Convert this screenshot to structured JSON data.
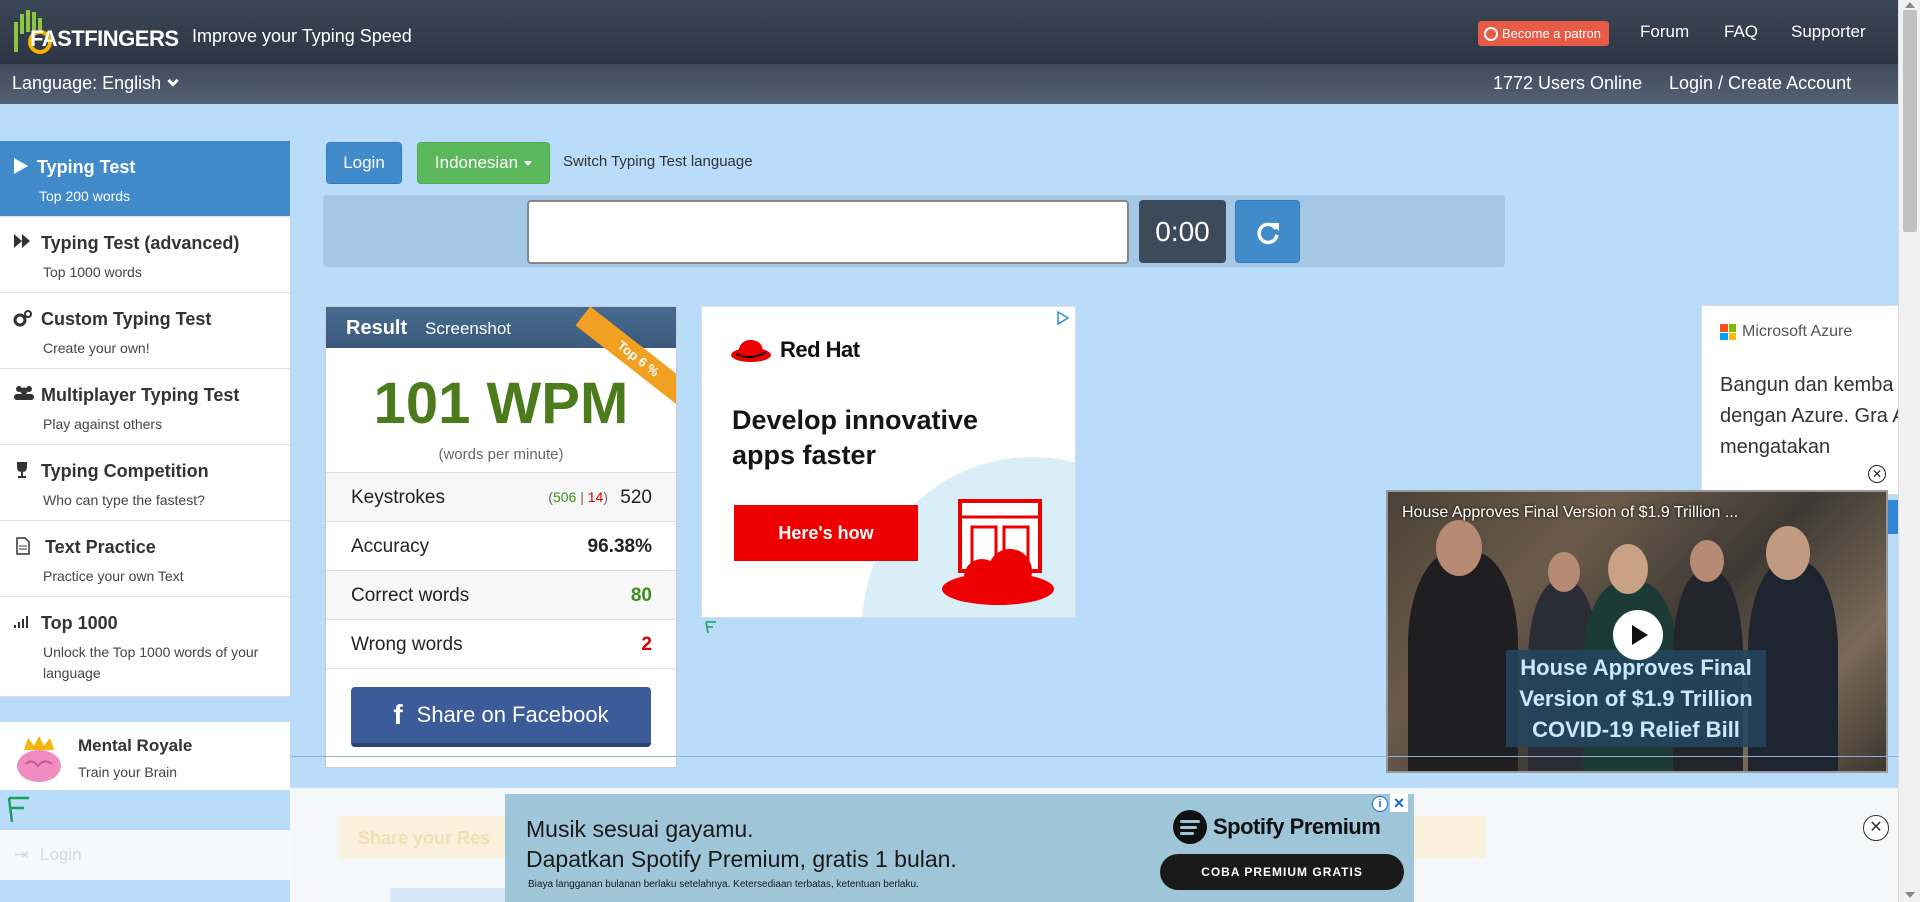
{
  "header": {
    "logo_text": "FASTFINGERS",
    "tagline": "Improve your Typing Speed",
    "patron_label": "Become a patron",
    "nav": [
      "Forum",
      "FAQ",
      "Supporter"
    ]
  },
  "subheader": {
    "language": "Language: English",
    "users_online": "1772 Users Online",
    "login_create": "Login / Create Account"
  },
  "sidebar": {
    "items": [
      {
        "title": "Typing Test",
        "subtitle": "Top 200 words",
        "icon": "play-icon",
        "active": true
      },
      {
        "title": "Typing Test (advanced)",
        "subtitle": "Top 1000 words",
        "icon": "fast-forward-icon"
      },
      {
        "title": "Custom Typing Test",
        "subtitle": "Create your own!",
        "icon": "gears-icon"
      },
      {
        "title": "Multiplayer Typing Test",
        "subtitle": "Play against others",
        "icon": "users-icon"
      },
      {
        "title": "Typing Competition",
        "subtitle": "Who can type the fastest?",
        "icon": "trophy-icon"
      },
      {
        "title": "Text Practice",
        "subtitle": "Practice your own Text",
        "icon": "file-icon"
      },
      {
        "title": "Top 1000",
        "subtitle": "Unlock the Top 1000 words of your language",
        "icon": "signal-icon"
      }
    ],
    "mental": {
      "title": "Mental Royale",
      "subtitle": "Train your Brain"
    },
    "login": "Login"
  },
  "controls": {
    "login": "Login",
    "language": "Indonesian",
    "switch_label": "Switch Typing Test language",
    "timer": "0:00",
    "input_value": ""
  },
  "result": {
    "title": "Result",
    "screenshot": "Screenshot",
    "ribbon": "Top 6 %",
    "wpm": "101 WPM",
    "wpm_sub": "(words per minute)",
    "keystrokes": {
      "label": "Keystrokes",
      "correct": "506",
      "sep": "|",
      "wrong": "14",
      "open": "(",
      "close": ")",
      "total": "520"
    },
    "accuracy": {
      "label": "Accuracy",
      "value": "96.38%"
    },
    "correct_words": {
      "label": "Correct words",
      "value": "80"
    },
    "wrong_words": {
      "label": "Wrong words",
      "value": "2"
    },
    "share_fb": "Share on Facebook"
  },
  "ads": {
    "redhat": {
      "logo": "Red Hat",
      "headline": "Develop innovative apps faster",
      "cta": "Here's how"
    },
    "azure": {
      "logo": "Microsoft Azure",
      "text": "Bangun dan kemba dengan Azure. Gra Anda mengatakan"
    },
    "video": {
      "title": "House Approves Final Version of $1.9 Trillion ...",
      "caption": "House Approves Final Version of $1.9 Trillion COVID-19 Relief Bill"
    },
    "spotify": {
      "line1": "Musik sesuai gayamu.",
      "line2": "Dapatkan Spotify Premium, gratis 1 bulan.",
      "fine": "Biaya langganan bulanan berlaku setelahnya. Ketersediaan terbatas, ketentuan berlaku.",
      "logo": "Spotify Premium",
      "cta": "COBA PREMIUM GRATIS"
    },
    "share_result": "Share your Res"
  },
  "colors": {
    "accent_blue": "#428bca",
    "accent_green": "#5cb85c",
    "wpm_green": "#4b7b1b",
    "error_red": "#d20000",
    "ribbon_orange": "#f2a022"
  }
}
